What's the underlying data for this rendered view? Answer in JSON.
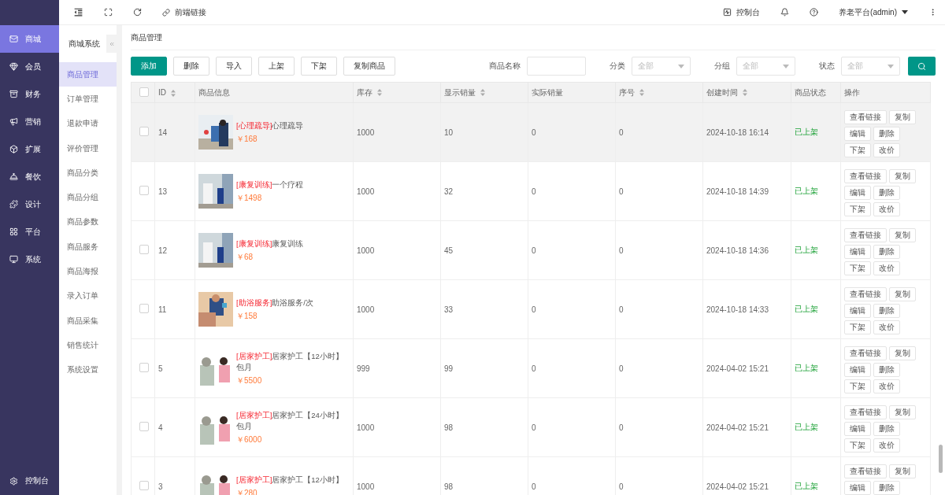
{
  "rail": {
    "items": [
      {
        "label": "商城",
        "selected": true
      },
      {
        "label": "会员",
        "selected": false
      },
      {
        "label": "财务",
        "selected": false
      },
      {
        "label": "营销",
        "selected": false
      },
      {
        "label": "扩展",
        "selected": false
      },
      {
        "label": "餐饮",
        "selected": false
      },
      {
        "label": "设计",
        "selected": false
      },
      {
        "label": "平台",
        "selected": false
      },
      {
        "label": "系统",
        "selected": false
      }
    ],
    "footer": {
      "label": "控制台"
    }
  },
  "topbar": {
    "link_label": "前端链接",
    "console_label": "控制台",
    "user_label": "养老平台(admin)"
  },
  "subnav": {
    "title": "商城系统",
    "items": [
      {
        "label": "商品管理",
        "selected": true
      },
      {
        "label": "订单管理",
        "selected": false
      },
      {
        "label": "退款申请",
        "selected": false
      },
      {
        "label": "评价管理",
        "selected": false
      },
      {
        "label": "商品分类",
        "selected": false
      },
      {
        "label": "商品分组",
        "selected": false
      },
      {
        "label": "商品参数",
        "selected": false
      },
      {
        "label": "商品服务",
        "selected": false
      },
      {
        "label": "商品海报",
        "selected": false
      },
      {
        "label": "录入订单",
        "selected": false
      },
      {
        "label": "商品采集",
        "selected": false
      },
      {
        "label": "销售统计",
        "selected": false
      },
      {
        "label": "系统设置",
        "selected": false
      }
    ]
  },
  "breadcrumb": "商品管理",
  "toolbar": {
    "buttons": [
      {
        "label": "添加",
        "kind": "primary"
      },
      {
        "label": "删除",
        "kind": "default"
      },
      {
        "label": "导入",
        "kind": "default"
      },
      {
        "label": "上架",
        "kind": "default"
      },
      {
        "label": "下架",
        "kind": "default"
      },
      {
        "label": "复制商品",
        "kind": "default"
      }
    ],
    "filters": [
      {
        "label": "商品名称",
        "kind": "input"
      },
      {
        "label": "分类",
        "kind": "select",
        "placeholder": "全部"
      },
      {
        "label": "分组",
        "kind": "select",
        "placeholder": "全部"
      },
      {
        "label": "状态",
        "kind": "select",
        "placeholder": "全部"
      }
    ]
  },
  "table": {
    "select_all_checked": false,
    "columns": [
      {
        "label": "ID",
        "sortable": true
      },
      {
        "label": "商品信息",
        "sortable": false
      },
      {
        "label": "库存",
        "sortable": true
      },
      {
        "label": "显示销量",
        "sortable": true
      },
      {
        "label": "实际销量",
        "sortable": false
      },
      {
        "label": "序号",
        "sortable": true
      },
      {
        "label": "创建时间",
        "sortable": true
      },
      {
        "label": "商品状态",
        "sortable": false
      },
      {
        "label": "操作",
        "sortable": false
      }
    ],
    "rows": [
      {
        "id": "14",
        "tag": "[心理疏导]",
        "name": "心理疏导",
        "price": "￥168",
        "stock": "1000",
        "shown_sales": "10",
        "real_sales": "0",
        "order": "0",
        "created": "2024-10-18 16:14",
        "status": "已上架",
        "highlighted": true,
        "checked": false,
        "actions": [
          "查看链接",
          "复制",
          "编辑",
          "删除",
          "下架",
          "改价"
        ]
      },
      {
        "id": "13",
        "tag": "[康复训练]",
        "name": "一个疗程",
        "price": "￥1498",
        "stock": "1000",
        "shown_sales": "32",
        "real_sales": "0",
        "order": "0",
        "created": "2024-10-18 14:39",
        "status": "已上架",
        "highlighted": false,
        "checked": false,
        "actions": [
          "查看链接",
          "复制",
          "编辑",
          "删除",
          "下架",
          "改价"
        ]
      },
      {
        "id": "12",
        "tag": "[康复训练]",
        "name": "康复训练",
        "price": "￥68",
        "stock": "1000",
        "shown_sales": "45",
        "real_sales": "0",
        "order": "0",
        "created": "2024-10-18 14:36",
        "status": "已上架",
        "highlighted": false,
        "checked": false,
        "actions": [
          "查看链接",
          "复制",
          "编辑",
          "删除",
          "下架",
          "改价"
        ]
      },
      {
        "id": "11",
        "tag": "[助浴服务]",
        "name": "助浴服务/次",
        "price": "￥158",
        "stock": "1000",
        "shown_sales": "33",
        "real_sales": "0",
        "order": "0",
        "created": "2024-10-18 14:33",
        "status": "已上架",
        "highlighted": false,
        "checked": false,
        "actions": [
          "查看链接",
          "复制",
          "编辑",
          "删除",
          "下架",
          "改价"
        ]
      },
      {
        "id": "5",
        "tag": "[居家护工]",
        "name": "居家护工【12小时】包月",
        "price": "￥5500",
        "stock": "999",
        "shown_sales": "99",
        "real_sales": "0",
        "order": "0",
        "created": "2024-04-02 15:21",
        "status": "已上架",
        "highlighted": false,
        "checked": false,
        "actions": [
          "查看链接",
          "复制",
          "编辑",
          "删除",
          "下架",
          "改价"
        ]
      },
      {
        "id": "4",
        "tag": "[居家护工]",
        "name": "居家护工【24小时】包月",
        "price": "￥6000",
        "stock": "1000",
        "shown_sales": "98",
        "real_sales": "0",
        "order": "0",
        "created": "2024-04-02 15:21",
        "status": "已上架",
        "highlighted": false,
        "checked": false,
        "actions": [
          "查看链接",
          "复制",
          "编辑",
          "删除",
          "下架",
          "改价"
        ]
      },
      {
        "id": "3",
        "tag": "[居家护工]",
        "name": "居家护工【12小时】",
        "price": "￥280",
        "stock": "1000",
        "shown_sales": "98",
        "real_sales": "0",
        "order": "0",
        "created": "2024-04-02 15:21",
        "status": "已上架",
        "highlighted": false,
        "checked": false,
        "actions": [
          "查看链接",
          "复制",
          "编辑",
          "删除"
        ]
      }
    ]
  }
}
